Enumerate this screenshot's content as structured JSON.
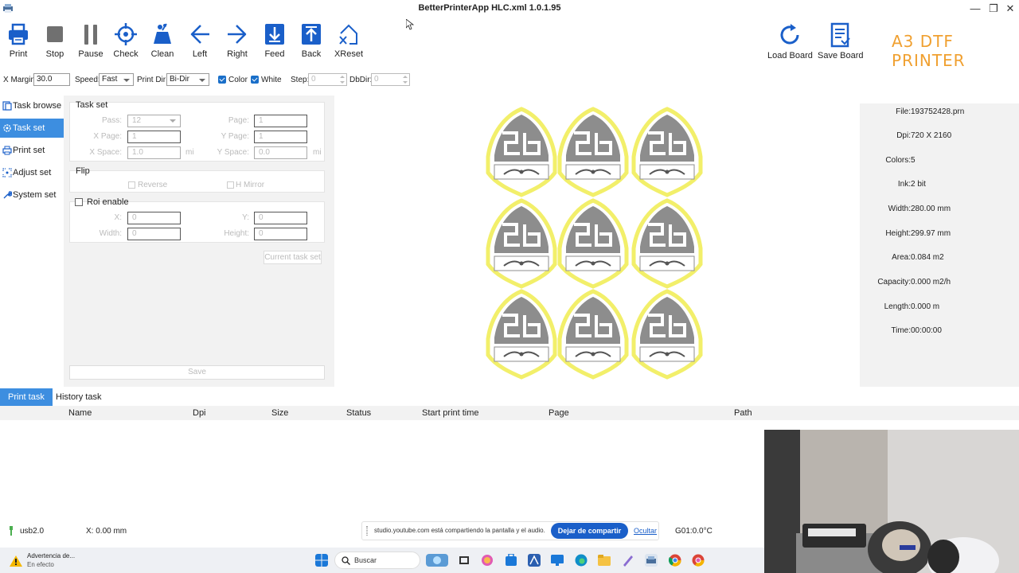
{
  "window": {
    "title": "BetterPrinterApp HLC.xml 1.0.1.95",
    "controls": [
      "—",
      "❐",
      "✕"
    ]
  },
  "toolbar": {
    "buttons": [
      {
        "label": "Print",
        "icon": "printer-icon"
      },
      {
        "label": "Stop",
        "icon": "stop-icon"
      },
      {
        "label": "Pause",
        "icon": "pause-icon"
      },
      {
        "label": "Check",
        "icon": "crosshair-icon"
      },
      {
        "label": "Clean",
        "icon": "clean-icon"
      },
      {
        "label": "Left",
        "icon": "arrow-left-icon"
      },
      {
        "label": "Right",
        "icon": "arrow-right-icon"
      },
      {
        "label": "Feed",
        "icon": "feed-down-icon"
      },
      {
        "label": "Back",
        "icon": "back-up-icon"
      },
      {
        "label": "XReset",
        "icon": "x-home-icon"
      }
    ],
    "load_board": "Load Board",
    "save_board": "Save Board",
    "brand": "A3 DTF PRINTER"
  },
  "options": {
    "x_margin_label": "X Margin:",
    "x_margin_value": "30.0",
    "speed_label": "Speed:",
    "speed_value": "Fast",
    "print_dir_label": "Print Dir:",
    "print_dir_value": "Bi-Dir",
    "color_label": "Color",
    "white_label": "White",
    "step_label": "Step:",
    "step_value": "0",
    "dbdir_label": "DbDir:",
    "dbdir_value": "0"
  },
  "nav": {
    "items": [
      {
        "label": "Task browse",
        "icon": "task-browse-icon"
      },
      {
        "label": "Task set",
        "icon": "gear-icon"
      },
      {
        "label": "Print set",
        "icon": "printer-small-icon"
      },
      {
        "label": "Adjust set",
        "icon": "adjust-icon"
      },
      {
        "label": "System set",
        "icon": "wrench-icon"
      }
    ]
  },
  "task_set": {
    "title": "Task set",
    "pass_label": "Pass:",
    "pass_value": "12",
    "page_label": "Page:",
    "page_value": "1",
    "x_page_label": "X Page:",
    "x_page_value": "1",
    "y_page_label": "Y Page:",
    "y_page_value": "1",
    "x_space_label": "X Space:",
    "x_space_value": "1.0",
    "y_space_label": "Y Space:",
    "y_space_value": "0.0",
    "unit": "mi",
    "flip_title": "Flip",
    "reverse_label": "Reverse",
    "hmirror_label": "H Mirror",
    "roi_label": "Roi enable",
    "roi_x_label": "X:",
    "roi_x_value": "0",
    "roi_y_label": "Y:",
    "roi_y_value": "0",
    "roi_w_label": "Width:",
    "roi_w_value": "0",
    "roi_h_label": "Height:",
    "roi_h_value": "0",
    "current_task_set": "Current task set",
    "save": "Save"
  },
  "file_info": {
    "rows": [
      {
        "k": "File:",
        "v": "193752428.prn"
      },
      {
        "k": "Dpi:",
        "v": "720 X 2160"
      },
      {
        "k": "Colors:",
        "v": "5"
      },
      {
        "k": "Ink:",
        "v": "2 bit"
      },
      {
        "k": "Width:",
        "v": "280.00 mm"
      },
      {
        "k": "Height:",
        "v": "299.97 mm"
      },
      {
        "k": "Area:",
        "v": "0.084 m2"
      },
      {
        "k": "Capacity:",
        "v": "0.000 m2/h"
      },
      {
        "k": "Length:",
        "v": "0.000 m"
      },
      {
        "k": "Time:",
        "v": "00:00:00"
      }
    ]
  },
  "tasks": {
    "tabs": [
      "Print task",
      "History task"
    ],
    "columns": [
      "Name",
      "Dpi",
      "Size",
      "Status",
      "Start print time",
      "Page",
      "Path"
    ]
  },
  "statusbar": {
    "port": "usb2.0",
    "x_pos": "X: 0.00 mm",
    "temp": "G01:0.0°C"
  },
  "share_notice": {
    "message": "studio.youtube.com está compartiendo la pantalla y el audio.",
    "stop_label": "Dejar de compartir",
    "hide_label": "Ocultar"
  },
  "taskbar": {
    "warning_title": "Advertencia de...",
    "warning_sub": "En efecto",
    "search_placeholder": "Buscar"
  },
  "colors": {
    "accent": "#3d8ee0",
    "brand": "#f0a030",
    "icon_blue": "#1a5fc9",
    "shield_yellow": "#f2ef6a",
    "shield_gray": "#8d8d8d"
  }
}
